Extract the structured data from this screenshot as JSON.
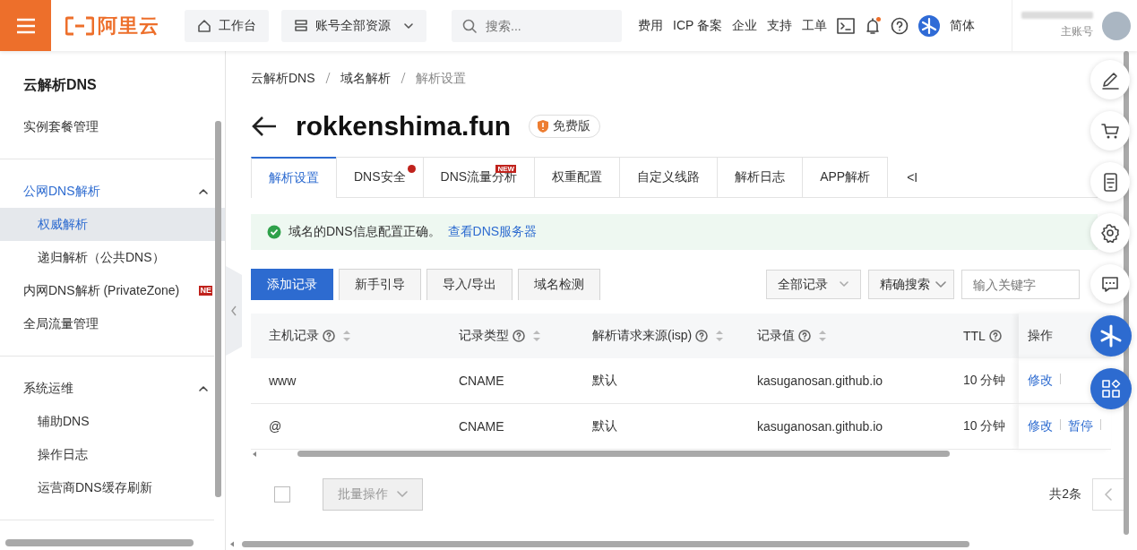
{
  "topbar": {
    "brand": "阿里云",
    "workbench": "工作台",
    "resources": "账号全部资源",
    "search": {
      "placeholder": "搜索..."
    },
    "links": [
      "费用",
      "ICP 备案",
      "企业",
      "支持",
      "工单"
    ],
    "notification_dot": true,
    "language": "简体",
    "account_role": "主账号"
  },
  "sidebar": {
    "title": "云解析DNS",
    "items": [
      {
        "label": "实例套餐管理",
        "kind": "link",
        "selected": false
      },
      {
        "kind": "divider"
      },
      {
        "label": "公网DNS解析",
        "kind": "group",
        "active": true,
        "expanded": true,
        "children": [
          {
            "label": "权威解析",
            "selected": true
          },
          {
            "label": "递归解析（公共DNS）",
            "selected": false
          }
        ]
      },
      {
        "label": "内网DNS解析 (PrivateZone)",
        "kind": "link",
        "selected": false,
        "badge": "NE"
      },
      {
        "label": "全局流量管理",
        "kind": "link",
        "selected": false
      },
      {
        "kind": "divider"
      },
      {
        "label": "系统运维",
        "kind": "group",
        "active": false,
        "expanded": true,
        "children": [
          {
            "label": "辅助DNS",
            "selected": false
          },
          {
            "label": "操作日志",
            "selected": false
          },
          {
            "label": "运营商DNS缓存刷新",
            "selected": false
          }
        ]
      },
      {
        "kind": "divider"
      }
    ]
  },
  "breadcrumb": [
    "云解析DNS",
    "域名解析",
    "解析设置"
  ],
  "domain": {
    "name": "rokkenshima.fun",
    "edition": "免费版"
  },
  "tabs": [
    {
      "label": "解析设置",
      "selected": true
    },
    {
      "label": "DNS安全",
      "selected": false,
      "dot": true
    },
    {
      "label": "DNS流量分析",
      "selected": false,
      "badge_text": "NEW"
    },
    {
      "label": "权重配置",
      "selected": false
    },
    {
      "label": "自定义线路",
      "selected": false
    },
    {
      "label": "解析日志",
      "selected": false
    },
    {
      "label": "APP解析",
      "selected": false
    }
  ],
  "tabs_more": "<I",
  "alert": {
    "message": "域名的DNS信息配置正确。",
    "link": "查看DNS服务器"
  },
  "toolbar": {
    "buttons": [
      {
        "label": "添加记录",
        "primary": true
      },
      {
        "label": "新手引导",
        "primary": false
      },
      {
        "label": "导入/导出",
        "primary": false
      },
      {
        "label": "域名检测",
        "primary": false
      }
    ],
    "filter": "全部记录",
    "search_mode": "精确搜索",
    "search": {
      "placeholder": "输入关键字"
    }
  },
  "table": {
    "columns": [
      {
        "label": "主机记录",
        "help": true,
        "sortable": true
      },
      {
        "label": "记录类型",
        "help": true,
        "sortable": true
      },
      {
        "label": "解析请求来源(isp)",
        "help": true,
        "sortable": true
      },
      {
        "label": "记录值",
        "help": true,
        "sortable": true
      },
      {
        "label": "TTL",
        "help": true,
        "sortable": false
      },
      {
        "label": "操作",
        "help": false,
        "sortable": false
      }
    ],
    "rows": [
      {
        "cells": [
          "www",
          "CNAME",
          "默认",
          "kasuganosan.github.io",
          "10 分钟"
        ],
        "actions": [
          "修改"
        ]
      },
      {
        "cells": [
          "@",
          "CNAME",
          "默认",
          "kasuganosan.github.io",
          "10 分钟"
        ],
        "actions": [
          "修改",
          "暂停"
        ]
      }
    ]
  },
  "footer": {
    "select_all": false,
    "batch": {
      "label": "批量操作",
      "disabled": true
    },
    "total": "共2条"
  }
}
